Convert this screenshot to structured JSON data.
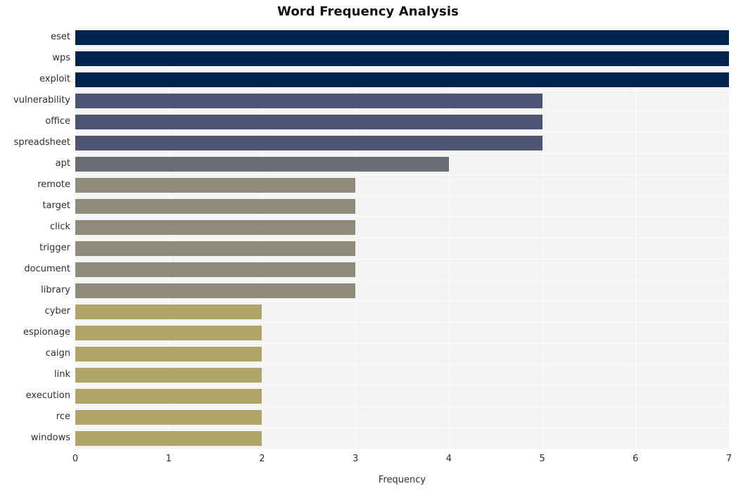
{
  "chart_data": {
    "type": "bar",
    "orientation": "horizontal",
    "title": "Word Frequency Analysis",
    "xlabel": "Frequency",
    "ylabel": "",
    "xlim": [
      0,
      7
    ],
    "xticks": [
      0,
      1,
      2,
      3,
      4,
      5,
      6,
      7
    ],
    "xticklabels": [
      "0",
      "1",
      "2",
      "3",
      "4",
      "5",
      "6",
      "7"
    ],
    "grid": true,
    "legend": null,
    "categories": [
      "eset",
      "wps",
      "exploit",
      "vulnerability",
      "office",
      "spreadsheet",
      "apt",
      "remote",
      "target",
      "click",
      "trigger",
      "document",
      "library",
      "cyber",
      "espionage",
      "caign",
      "link",
      "execution",
      "rce",
      "windows"
    ],
    "values": [
      7,
      7,
      7,
      5,
      5,
      5,
      4,
      3,
      3,
      3,
      3,
      3,
      3,
      2,
      2,
      2,
      2,
      2,
      2,
      2
    ],
    "bar_colors": [
      "#01234f",
      "#01234f",
      "#01234f",
      "#4e5471",
      "#4e5471",
      "#4e5471",
      "#6b6d74",
      "#8e8b7b",
      "#8e8b7b",
      "#8e8b7b",
      "#8e8b7b",
      "#8e8b7b",
      "#8e8b7b",
      "#b0a469",
      "#b0a469",
      "#b0a469",
      "#b0a469",
      "#b0a469",
      "#b0a469",
      "#b0a469"
    ],
    "plot_background": "#f4f4f5",
    "gridline_color": "#fdfdfd",
    "figure_background": "#ffffff"
  }
}
